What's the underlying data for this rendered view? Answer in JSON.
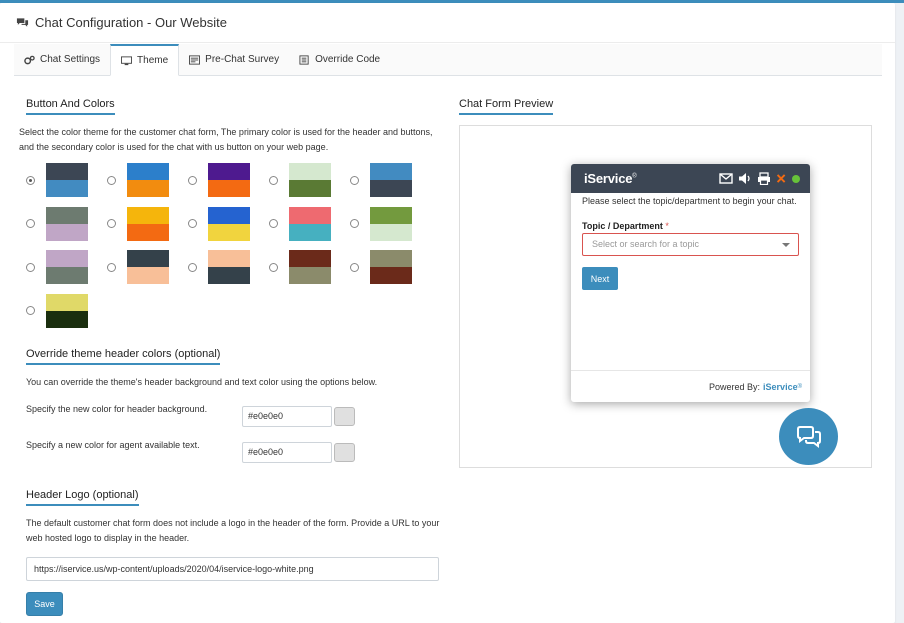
{
  "header": {
    "title": "Chat Configuration - Our Website",
    "icon": "comments-icon"
  },
  "tabs": [
    {
      "label": "Chat Settings",
      "icon": "cogs-icon",
      "active": false
    },
    {
      "label": "Theme",
      "icon": "desktop-icon",
      "active": true
    },
    {
      "label": "Pre-Chat Survey",
      "icon": "form-icon",
      "active": false
    },
    {
      "label": "Override Code",
      "icon": "code-icon",
      "active": false
    }
  ],
  "button_colors": {
    "title": "Button And Colors",
    "description": "Select the color theme for the customer chat form, The primary color is used for the header and buttons, and the secondary color is used for the chat with us button on your web page.",
    "selected_index": 0,
    "themes": [
      {
        "primary": "#3c4654",
        "secondary": "#428bc1"
      },
      {
        "primary": "#2c7fcb",
        "secondary": "#f28c0f"
      },
      {
        "primary": "#4e1a8f",
        "secondary": "#f36a12"
      },
      {
        "primary": "#d5e8cf",
        "secondary": "#5a7a34"
      },
      {
        "primary": "#428bc1",
        "secondary": "#3c4654"
      },
      {
        "primary": "#6d7b70",
        "secondary": "#c0a6c6"
      },
      {
        "primary": "#f5b50c",
        "secondary": "#f36a12"
      },
      {
        "primary": "#2563d0",
        "secondary": "#f1d43e"
      },
      {
        "primary": "#ee6a70",
        "secondary": "#46b0c0"
      },
      {
        "primary": "#739a3e",
        "secondary": "#d5e8cf"
      },
      {
        "primary": "#c0a6c6",
        "secondary": "#6d7b70"
      },
      {
        "primary": "#34414a",
        "secondary": "#f8bf98"
      },
      {
        "primary": "#f8bf98",
        "secondary": "#34414a"
      },
      {
        "primary": "#6b2a1a",
        "secondary": "#8b8b6b"
      },
      {
        "primary": "#8b8b6b",
        "secondary": "#6b2a1a"
      },
      {
        "primary": "#e0d968",
        "secondary": "#1a2e0e"
      }
    ]
  },
  "override": {
    "title": "Override theme header colors (optional)",
    "description": "You can override the theme's header background and text color using the options below.",
    "bg_label": "Specify the new color for header background.",
    "bg_value": "#e0e0e0",
    "text_label": "Specify a new color for agent available text.",
    "text_value": "#e0e0e0"
  },
  "logo": {
    "title": "Header Logo (optional)",
    "description": "The default customer chat form does not include a logo in the header of the form. Provide a URL to your web hosted logo to display in the header.",
    "url": "https://iservice.us/wp-content/uploads/2020/04/iservice-logo-white.png",
    "save_label": "Save"
  },
  "preview": {
    "title": "Chat Form Preview",
    "brand": "iService",
    "brand_mark": "®",
    "intro": "Please select the topic/department to begin your chat.",
    "topic_label": "Topic / Department",
    "required_mark": "*",
    "topic_placeholder": "Select or search for a topic",
    "next_label": "Next",
    "powered_by": "Powered By:",
    "powered_brand": "iService",
    "header_bg": "#3c4654",
    "status_color": "#67c23a",
    "accent": "#3c8dbc"
  }
}
